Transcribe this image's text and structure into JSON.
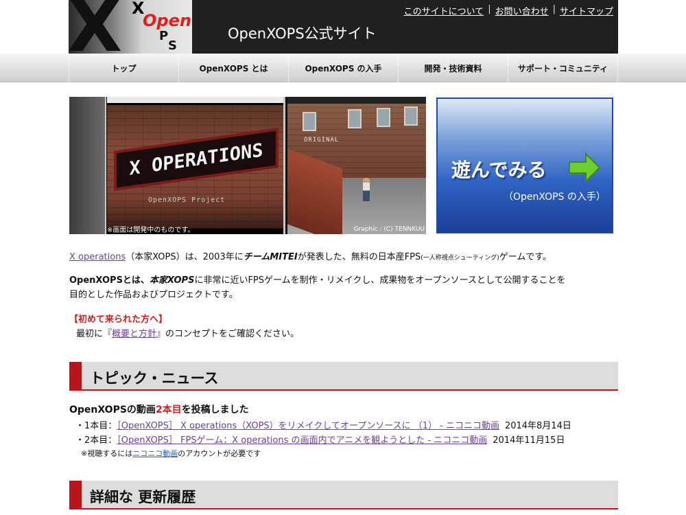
{
  "header": {
    "logo": {
      "x": "X",
      "x_small": "X",
      "open": "Open",
      "p": "P",
      "s": "S"
    },
    "site_title": "OpenXOPS公式サイト",
    "top_links": [
      "このサイトについて",
      "お問い合わせ",
      "サイトマップ"
    ],
    "separator": "|"
  },
  "nav": {
    "items": [
      "トップ",
      "OpenXOPS とは",
      "OpenXOPS の入手",
      "開発・技術資料",
      "サポート・コミュニティ"
    ]
  },
  "banner": {
    "sign_text": "X OPERATIONS",
    "project_text": "OpenXOPS Project",
    "original_text": "ORIGINAL",
    "caption_left": "※画面は開発中のものです。",
    "caption_right": "Graphic : (C) TENNKUU"
  },
  "play": {
    "title": "遊んでみる",
    "subtitle": "（OpenXOPS の入手）",
    "arrow_color": "#6ccf2e"
  },
  "intro": {
    "link": "X operations",
    "p1_a": "（本家XOPS）は、2003年に",
    "team": "チームMITEI",
    "p1_b": "が発表した、無料の日本産FPS",
    "p1_small": "(一人称視点シューティング)",
    "p1_c": "ゲームです。",
    "p2_a": "OpenXOPSとは、",
    "p2_em": "本家XOPS",
    "p2_b": "に非常に近いFPSゲームを制作・リメイクし、成果物をオープンソースとして公開することを",
    "p2_c": "目的とした作品およびプロジェクトです。",
    "first_title": "【初めて来られた方へ】",
    "first_a": "最初に『",
    "first_link": "概要と方針",
    "first_b": "』のコンセプトをご確認ください。"
  },
  "sections": {
    "topics": "トピック・ニュース",
    "history": "詳細な 更新履歴"
  },
  "news": {
    "head_a": "OpenXOPSの動画",
    "head_red": "2本目",
    "head_b": "を投稿しました",
    "items": [
      {
        "prefix": "・1本目：",
        "link": "［OpenXOPS］ X operations（XOPS）をリメイクしてオープンソースに （1） ‐ ニコニコ動画",
        "date": "2014年8月14日"
      },
      {
        "prefix": "・2本目：",
        "link": "［OpenXOPS］ FPSゲーム：X operations の画面内でアニメを観ようとした ‐ ニコニコ動画",
        "date": "2014年11月15日"
      }
    ],
    "note_a": "※視聴するには",
    "note_link": "ニコニコ動画",
    "note_b": "のアカウントが必要です"
  },
  "colors": {
    "accent_red": "#b8141a",
    "link_purple": "#6b3fa0",
    "header_bg": "#202020",
    "play_blue": "#2f63c4"
  }
}
